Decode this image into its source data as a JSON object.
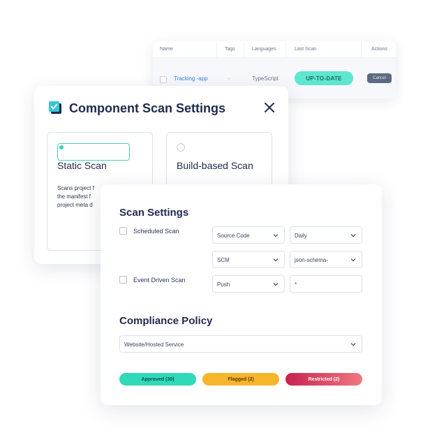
{
  "table": {
    "headers": [
      "Name",
      "Tags",
      "Languages",
      "Last Scan",
      "Actions"
    ],
    "row": {
      "name": "Tracking -app",
      "tags": "-",
      "language": "TypeScript",
      "last_scan": "UP-TO-DATE",
      "action": "Cancel"
    }
  },
  "component_scan": {
    "title": "Component Scan Settings",
    "icon": "checklist-icon",
    "options": [
      {
        "title": "Static Scan",
        "selected": true,
        "description_lines": [
          "Scans project f",
          "the manifest f",
          "project meta d"
        ]
      },
      {
        "title": "Build-based Scan",
        "selected": false
      }
    ]
  },
  "scan_settings": {
    "title": "Scan Settings",
    "scheduled_label": "Scheduled Scan",
    "event_label": "Event Driven Scan",
    "source_select": "Source Code",
    "frequency_select": "Daily",
    "provider_select": "SCM",
    "format_select": "json-schema-",
    "trigger_select": "Push",
    "pattern_input": "*"
  },
  "compliance": {
    "title": "Compliance Policy",
    "policy_select": "Website/Hosted Service",
    "badges": {
      "approved": "Approved (30)",
      "flagged": "Flagged (2)",
      "restricted": "Restricted (2)"
    }
  },
  "colors": {
    "accent_teal": "#36d1b4",
    "flagged_orange": "#f7b52c",
    "restricted_red": "#d63a5c"
  }
}
